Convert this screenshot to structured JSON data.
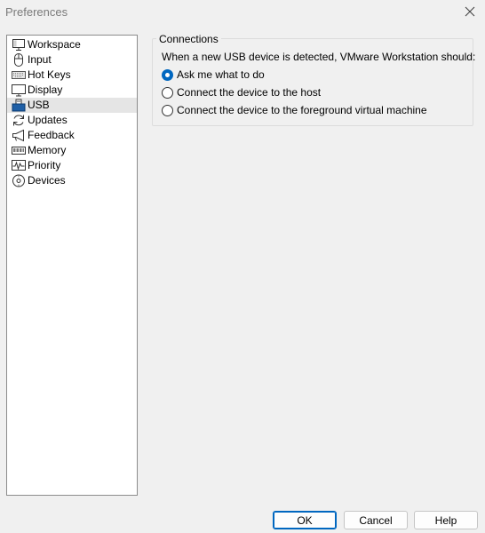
{
  "window": {
    "title": "Preferences"
  },
  "nav": {
    "items": [
      {
        "label": "Workspace",
        "icon": "workspace-icon"
      },
      {
        "label": "Input",
        "icon": "mouse-icon"
      },
      {
        "label": "Hot Keys",
        "icon": "keyboard-icon"
      },
      {
        "label": "Display",
        "icon": "monitor-icon"
      },
      {
        "label": "USB",
        "icon": "usb-icon",
        "selected": true
      },
      {
        "label": "Updates",
        "icon": "refresh-icon"
      },
      {
        "label": "Feedback",
        "icon": "megaphone-icon"
      },
      {
        "label": "Memory",
        "icon": "memory-icon"
      },
      {
        "label": "Priority",
        "icon": "pulse-icon"
      },
      {
        "label": "Devices",
        "icon": "devices-icon"
      }
    ]
  },
  "connections": {
    "legend": "Connections",
    "prompt": "When a new USB device is detected, VMware Workstation should:",
    "options": [
      {
        "label": "Ask me what to do",
        "checked": true
      },
      {
        "label": "Connect the device to the host",
        "checked": false
      },
      {
        "label": "Connect the device to the foreground virtual machine",
        "checked": false
      }
    ]
  },
  "buttons": {
    "ok": "OK",
    "cancel": "Cancel",
    "help": "Help"
  },
  "colors": {
    "accent": "#0067c0",
    "selection": "#e5e5e5"
  }
}
